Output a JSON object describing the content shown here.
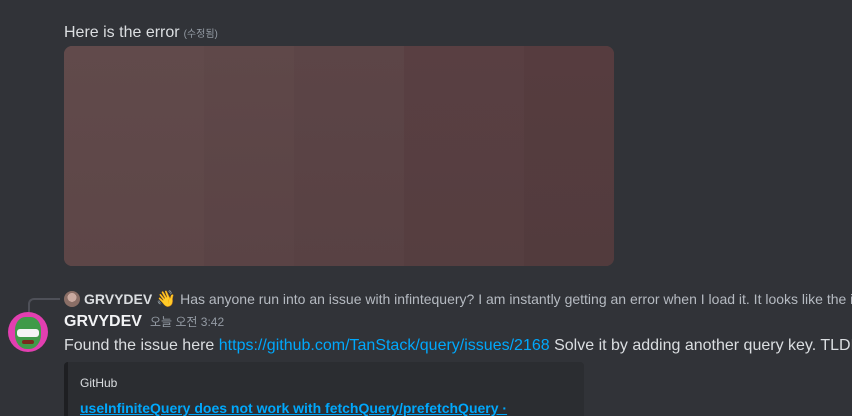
{
  "message_top": {
    "text": "Here is the error",
    "edited_label": "(수정됨)"
  },
  "reply": {
    "author": "GRVYDEV",
    "emoji": "👋",
    "text": "Has anyone run into an issue with infintequery? I am instantly getting an error when I load it. It looks like the internal"
  },
  "message": {
    "author": "GRVYDEV",
    "timestamp": "오늘 오전 3:42",
    "text_before": "Found the issue here",
    "link": "https://github.com/TanStack/query/issues/2168",
    "text_after": "Solve it by adding another query key. TLDR I w"
  },
  "embed": {
    "provider": "GitHub",
    "title": "useInfiniteQuery does not work with fetchQuery/prefetchQuery ·"
  },
  "colors": {
    "background": "#313338",
    "link": "#00a8fc",
    "avatar_bg": "#e23fb0"
  }
}
